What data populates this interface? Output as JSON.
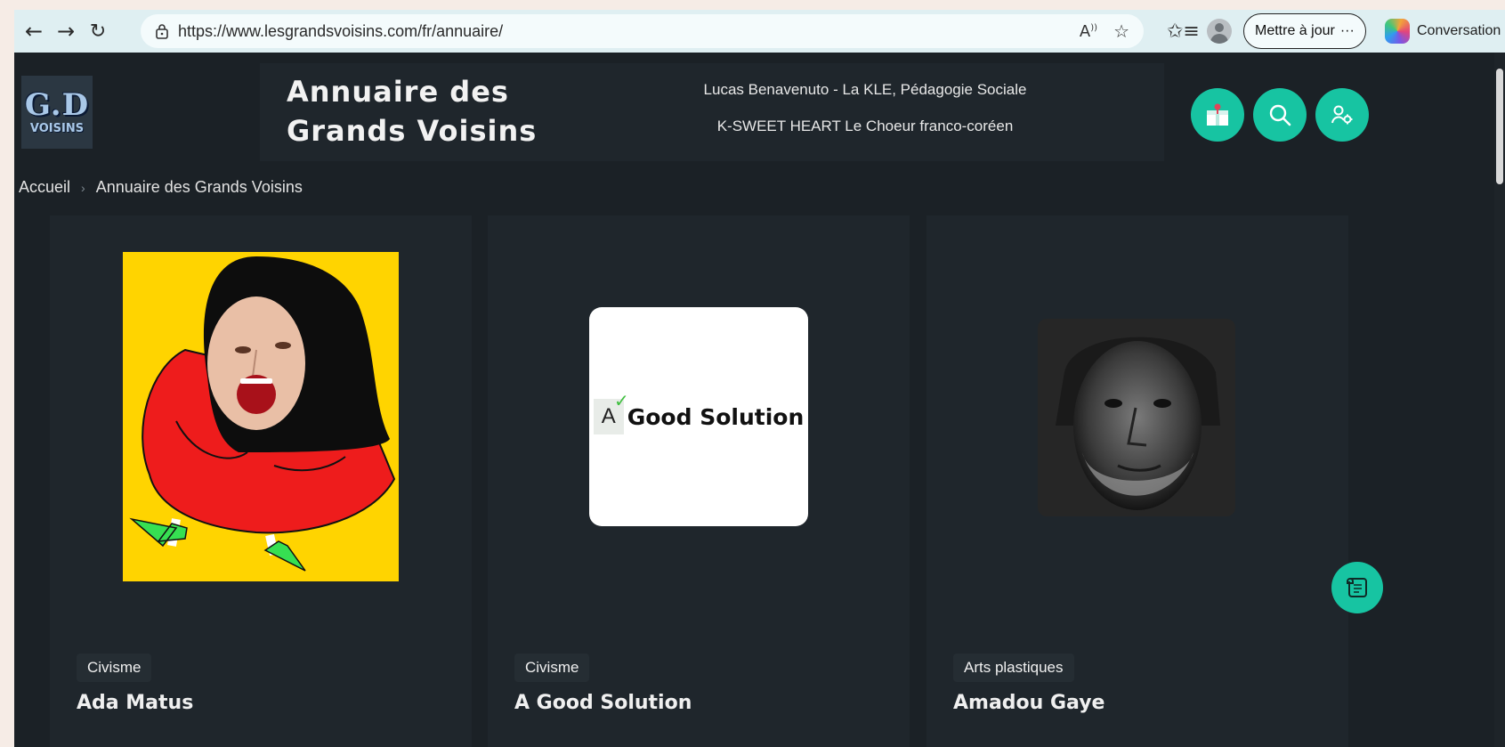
{
  "browser": {
    "url": "https://www.lesgrandsvoisins.com/fr/annuaire/",
    "update_label": "Mettre à jour",
    "update_more": "···",
    "copilot_label": "Conversation"
  },
  "site": {
    "logo_top": "G.D",
    "logo_bottom": "VOISINS",
    "title": "Annuaire des Grands Voisins",
    "ticker": [
      "Lucas Benavenuto - La KLE, Pédagogie Sociale",
      "K-SWEET HEART Le Choeur franco-coréen"
    ],
    "accent_color": "#17c4a2"
  },
  "breadcrumb": {
    "home": "Accueil",
    "current": "Annuaire des Grands Voisins"
  },
  "cards": [
    {
      "tag": "Civisme",
      "name": "Ada Matus"
    },
    {
      "tag": "Civisme",
      "name": "A Good Solution",
      "logo_letter": "A",
      "logo_text": "Good Solution"
    },
    {
      "tag": "Arts plastiques",
      "name": "Amadou Gaye"
    }
  ],
  "icons": {
    "back": "arrow-left-icon",
    "forward": "arrow-right-icon",
    "refresh": "refresh-icon",
    "lock": "lock-icon",
    "read_aloud": "read-aloud-icon",
    "favorite": "star-icon",
    "favorites": "favorites-icon",
    "shop": "shop-icon",
    "search": "search-icon",
    "account": "account-settings-icon",
    "scroll": "scroll-icon"
  }
}
